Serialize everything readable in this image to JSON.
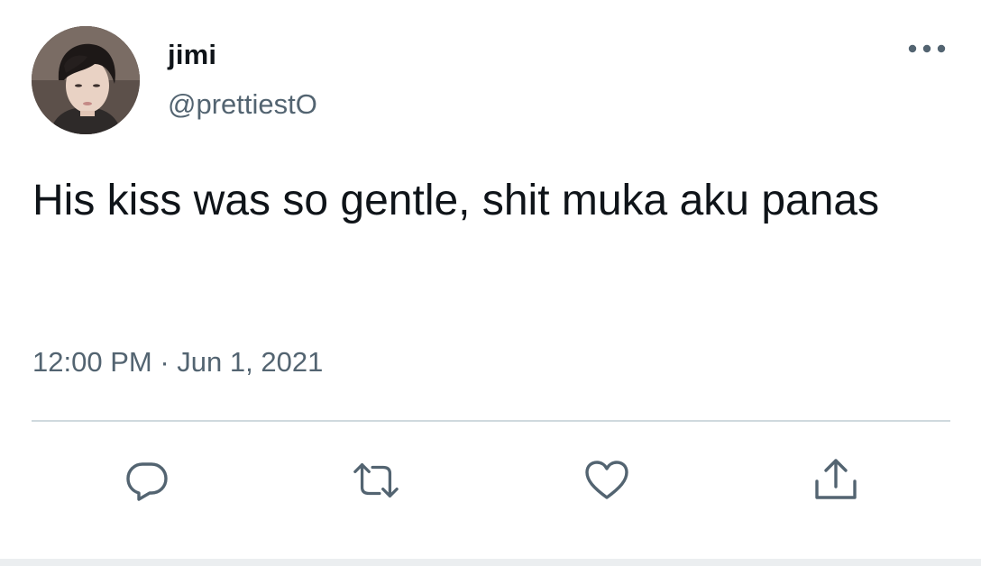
{
  "tweet": {
    "display_name": "jimi",
    "handle": "@prettiestO",
    "text": "His kiss was so gentle, shit muka aku panas",
    "time": "12:00 PM",
    "separator": "·",
    "date": "Jun 1, 2021"
  },
  "actions": {
    "reply_icon": "reply-icon",
    "retweet_icon": "retweet-icon",
    "like_icon": "heart-icon",
    "share_icon": "share-icon",
    "more_icon": "more-icon"
  },
  "colors": {
    "text_primary": "#0f1419",
    "text_secondary": "#536471",
    "divider": "#cfd9de"
  }
}
